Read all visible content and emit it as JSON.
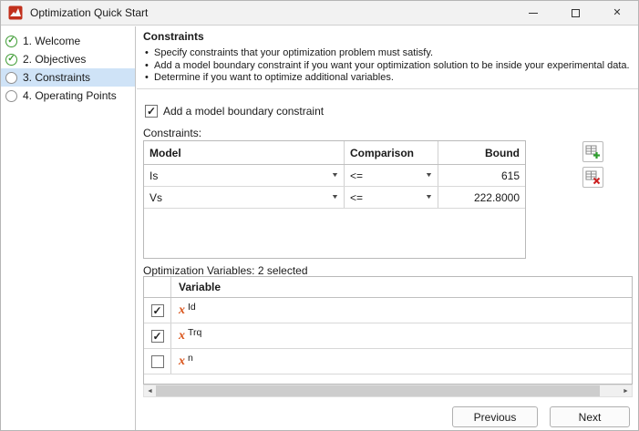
{
  "window": {
    "title": "Optimization Quick Start",
    "controls": {
      "close_glyph": "✕"
    }
  },
  "icons": {
    "dropdown": "▼",
    "scroll_left": "◄",
    "scroll_right": "►"
  },
  "colors": {
    "step_complete_green": "#3f9c35",
    "selection_blue": "#cfe3f7",
    "variable_symbol_orange": "#d95319"
  },
  "sidebar": {
    "items": [
      {
        "label": "1. Welcome",
        "status": "complete"
      },
      {
        "label": "2. Objectives",
        "status": "complete"
      },
      {
        "label": "3. Constraints",
        "status": "current"
      },
      {
        "label": "4. Operating Points",
        "status": "pending"
      }
    ]
  },
  "main": {
    "heading": "Constraints",
    "bullets": [
      "Specify constraints that your optimization problem must satisfy.",
      "Add a model boundary constraint if you want your optimization solution to be inside your experimental data.",
      "Determine if you want to optimize additional variables."
    ],
    "boundary_checkbox": {
      "label": "Add a model boundary constraint",
      "checked": true
    },
    "constraints": {
      "label": "Constraints:",
      "columns": [
        "Model",
        "Comparison",
        "Bound"
      ],
      "rows": [
        {
          "model": "Is",
          "comparison": "<=",
          "bound": "615"
        },
        {
          "model": "Vs",
          "comparison": "<=",
          "bound": "222.8000"
        }
      ]
    },
    "variables": {
      "label": "Optimization Variables: 2 selected",
      "column": "Variable",
      "symbol": "x",
      "rows": [
        {
          "name": "Id",
          "checked": true
        },
        {
          "name": "Trq",
          "checked": true
        },
        {
          "name": "n",
          "checked": false
        }
      ]
    },
    "buttons": {
      "previous": "Previous",
      "next": "Next"
    }
  }
}
